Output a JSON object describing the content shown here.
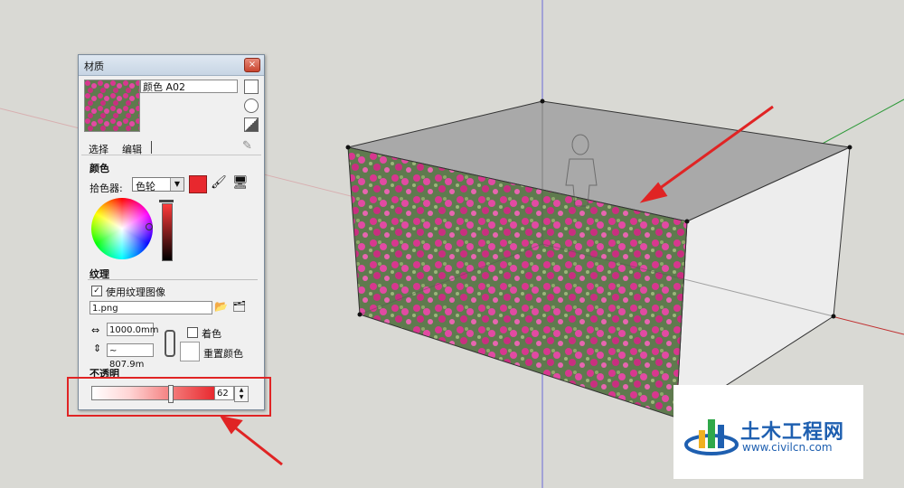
{
  "panel": {
    "title": "材质",
    "close_glyph": "×",
    "material_name": "颜色 A02",
    "tabs": [
      "选择",
      "编辑"
    ],
    "color_section": "颜色",
    "picker_label": "拾色器:",
    "picker_value": "色轮",
    "texture_section": "纹理",
    "use_texture_label": "使用纹理图像",
    "use_texture_checked": true,
    "texture_file": "1.png",
    "width_value": "1000.0mm",
    "height_value": "~ 807.9m",
    "colorize_label": "着色",
    "reset_color_label": "重置颜色",
    "opacity_section": "不透明",
    "opacity_value": "62",
    "swatch_color": "#e8282e"
  },
  "logo": {
    "name": "土木工程网",
    "url": "www.civilcn.com",
    "color": "#1e5fb0"
  },
  "icons": [
    "close-icon",
    "eyedropper-icon",
    "paint-bucket-icon",
    "screen-sample-icon",
    "link-chain-icon",
    "width-arrows-icon",
    "height-arrows-icon",
    "open-file-icon",
    "export-icon"
  ]
}
